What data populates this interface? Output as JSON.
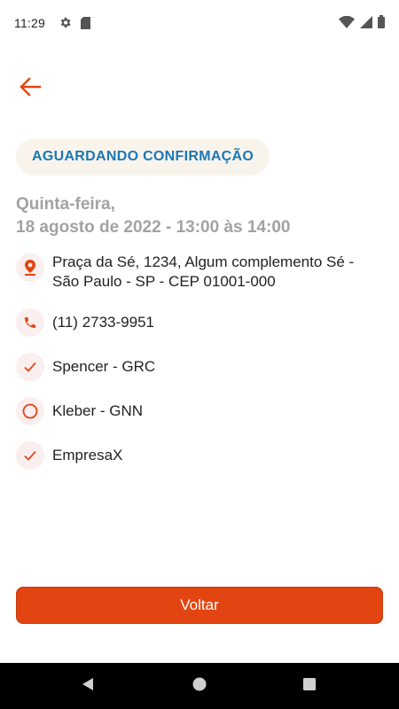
{
  "status_bar": {
    "time": "11:29",
    "left_icons": [
      "settings-icon",
      "sim-card-icon"
    ],
    "right_icons": [
      "wifi-icon",
      "signal-icon",
      "battery-icon"
    ]
  },
  "header": {
    "back_icon": "arrow-left-icon"
  },
  "appointment": {
    "status": "AGUARDANDO CONFIRMAÇÃO",
    "date_line1": "Quinta-feira,",
    "date_line2": "18 agosto de 2022 - 13:00 às 14:00"
  },
  "details": [
    {
      "icon": "location-pin-icon",
      "line1": "Praça da Sé, 1234, Algum complemento Sé -",
      "line2": "São Paulo - SP - CEP 01001-000"
    },
    {
      "icon": "phone-icon",
      "line1": "(11) 2733-9951"
    },
    {
      "icon": "check-icon",
      "line1": "Spencer - GRC"
    },
    {
      "icon": "circle-icon",
      "line1": "Kleber - GNN"
    },
    {
      "icon": "check-icon",
      "line1": "EmpresaX"
    }
  ],
  "actions": {
    "back_label": "Voltar"
  },
  "colors": {
    "accent": "#e34512",
    "status_text": "#1a78b5",
    "status_bg": "#f8f4ec",
    "muted_text": "#a2a2a2",
    "icon_bg": "#fbeeee"
  }
}
